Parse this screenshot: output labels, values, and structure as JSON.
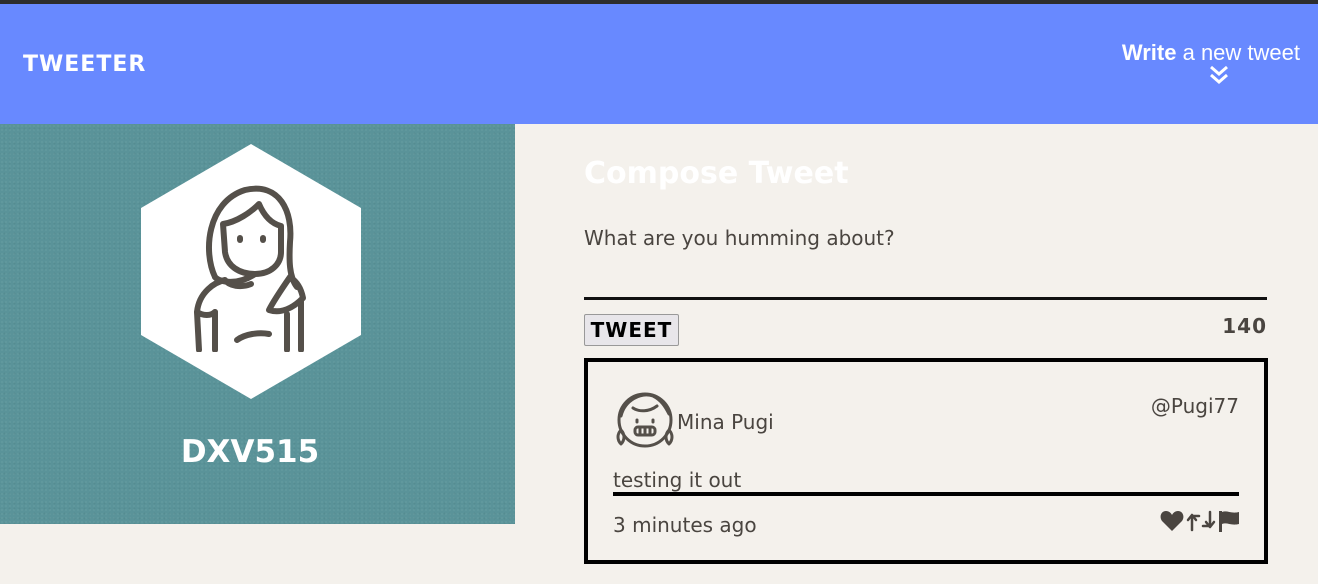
{
  "nav": {
    "brand": "TWEETER",
    "write_bold": "Write",
    "write_rest": "a new tweet",
    "toggle_icon": "double-chevron-down-icon"
  },
  "profile": {
    "handle": "DXV515",
    "avatar_icon": "girl-avatar-icon"
  },
  "compose": {
    "title": "Compose Tweet",
    "placeholder": "What are you humming about?",
    "button_label": "TWEET",
    "char_count": "140"
  },
  "tweet": {
    "avatar_icon": "smiling-girl-avatar-icon",
    "name": "Mina Pugi",
    "username": "@Pugi77",
    "text": "testing it out",
    "time": "3 minutes ago",
    "actions": [
      "heart-icon",
      "retweet-icon",
      "flag-icon"
    ]
  },
  "colors": {
    "navbar": "#6889ff",
    "profile_bg": "#5a9399",
    "page_bg": "#f4f1ec",
    "text": "#4a4540"
  }
}
